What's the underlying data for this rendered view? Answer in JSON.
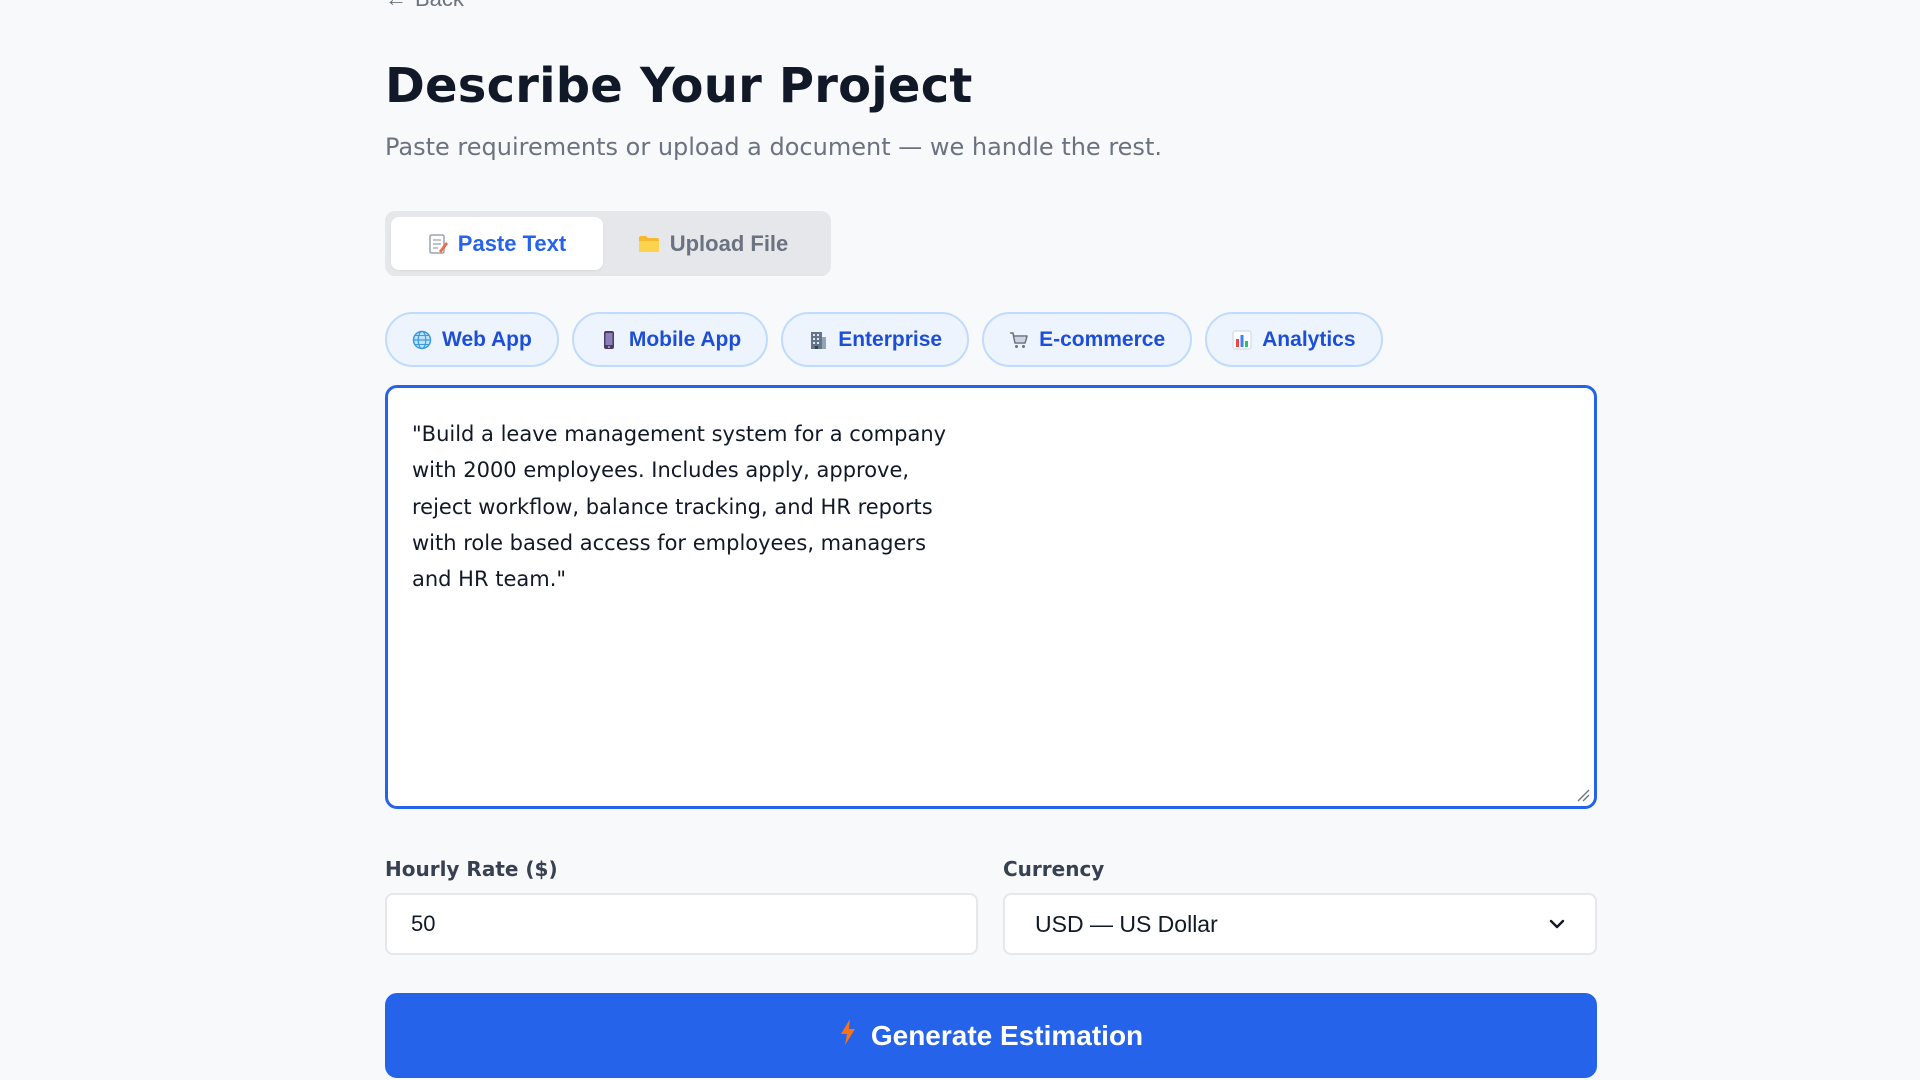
{
  "nav": {
    "back_label": "Back",
    "back_arrow": "←"
  },
  "header": {
    "title": "Describe Your Project",
    "subtitle": "Paste requirements or upload a document — we handle the rest."
  },
  "mode_tabs": [
    {
      "label": "Paste Text",
      "icon": "memo-icon",
      "active": true
    },
    {
      "label": "Upload File",
      "icon": "folder-icon",
      "active": false
    }
  ],
  "templates": [
    {
      "label": "Web App",
      "icon": "globe-icon"
    },
    {
      "label": "Mobile App",
      "icon": "mobile-phone-icon"
    },
    {
      "label": "Enterprise",
      "icon": "office-building-icon"
    },
    {
      "label": "E-commerce",
      "icon": "shopping-cart-icon"
    },
    {
      "label": "Analytics",
      "icon": "bar-chart-icon"
    }
  ],
  "requirements": {
    "value": "\"Build a leave management system for a company\nwith 2000 employees. Includes apply, approve,\nreject workflow, balance tracking, and HR reports\nwith role based access for employees, managers\nand HR team.\"\n"
  },
  "rate": {
    "label": "Hourly Rate ($)",
    "value": "50"
  },
  "currency": {
    "label": "Currency",
    "selected": "USD — US Dollar"
  },
  "generate": {
    "label": "Generate Estimation",
    "icon": "lightning-icon"
  },
  "colors": {
    "accent": "#2563eb",
    "chip_bg": "#eef4fd",
    "chip_border": "#bfdbfe",
    "page_bg": "#f8f9fb"
  }
}
